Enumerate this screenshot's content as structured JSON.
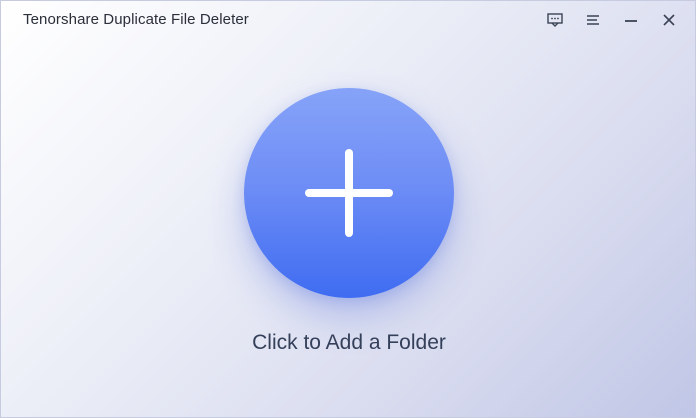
{
  "window": {
    "title": "Tenorshare Duplicate File Deleter"
  },
  "controls": {
    "icons": [
      "feedback-icon",
      "menu-icon",
      "minimize-icon",
      "close-icon"
    ]
  },
  "main": {
    "add_icon": "plus-icon",
    "add_label": "Click to Add a Folder"
  },
  "colors": {
    "accent": "#5b7ff5",
    "accent_light": "#86a3f8",
    "accent_dark": "#3f6cf1",
    "text": "#2b2f3a",
    "label_text": "#34405a"
  }
}
